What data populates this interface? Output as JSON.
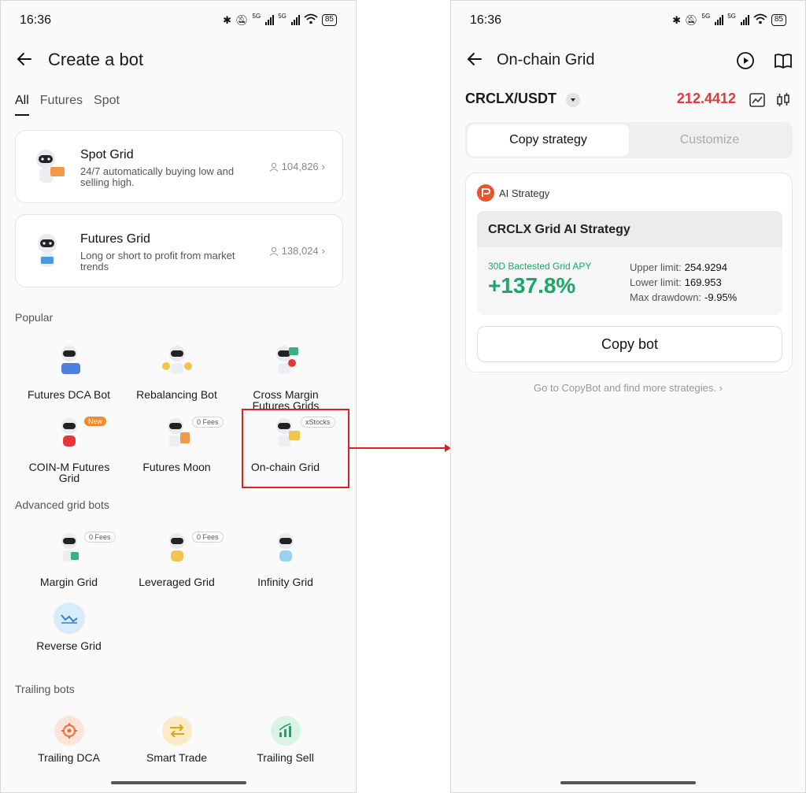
{
  "status": {
    "time": "16:36",
    "battery": "85",
    "net1": "5G",
    "net2": "5G"
  },
  "left": {
    "title": "Create a bot",
    "tabs": [
      "All",
      "Futures",
      "Spot"
    ],
    "cards": [
      {
        "title": "Spot Grid",
        "desc": "24/7 automatically buying low and selling high.",
        "count": "104,826"
      },
      {
        "title": "Futures Grid",
        "desc": "Long or short to profit from market trends",
        "count": "138,024"
      }
    ],
    "popular_label": "Popular",
    "popular": [
      {
        "name": "Futures DCA Bot",
        "icon": "robot-dca-icon"
      },
      {
        "name": "Rebalancing Bot",
        "icon": "robot-rebalance-icon"
      },
      {
        "name": "Cross Margin Futures Grids",
        "icon": "robot-cross-margin-icon"
      },
      {
        "name": "COIN-M Futures Grid",
        "icon": "robot-coinm-icon",
        "badge": "New"
      },
      {
        "name": "Futures Moon",
        "icon": "robot-moon-icon",
        "badge": "0 Fees"
      },
      {
        "name": "On-chain Grid",
        "icon": "robot-onchain-icon",
        "badge": "xStocks"
      }
    ],
    "advanced_label": "Advanced grid bots",
    "advanced": [
      {
        "name": "Margin Grid",
        "badge": "0 Fees"
      },
      {
        "name": "Leveraged Grid",
        "badge": "0 Fees"
      },
      {
        "name": "Infinity Grid"
      },
      {
        "name": "Reverse Grid"
      }
    ],
    "trailing_label": "Trailing bots",
    "trailing": [
      {
        "name": "Trailing DCA",
        "color": "#fde3d8"
      },
      {
        "name": "Smart Trade",
        "color": "#fdebc7"
      },
      {
        "name": "Trailing Sell",
        "color": "#d9f3e7"
      }
    ]
  },
  "right": {
    "title": "On-chain Grid",
    "pair": "CRCLX/USDT",
    "price": "212.4412",
    "seg": {
      "active": "Copy strategy",
      "inactive": "Customize"
    },
    "ai_label": "AI Strategy",
    "strategy_title": "CRCLX Grid AI Strategy",
    "apy_label": "30D Bactested Grid APY",
    "apy_value": "+137.8%",
    "upper_label": "Upper limit:",
    "upper_value": "254.9294",
    "lower_label": "Lower limit:",
    "lower_value": "169.953",
    "dd_label": "Max drawdown:",
    "dd_value": "-9.95%",
    "copy_btn": "Copy bot",
    "more_link": "Go to CopyBot and find more strategies."
  },
  "colors": {
    "price_red": "#e5373a",
    "apy_green": "#1aa869",
    "highlight_red": "#e02020"
  }
}
